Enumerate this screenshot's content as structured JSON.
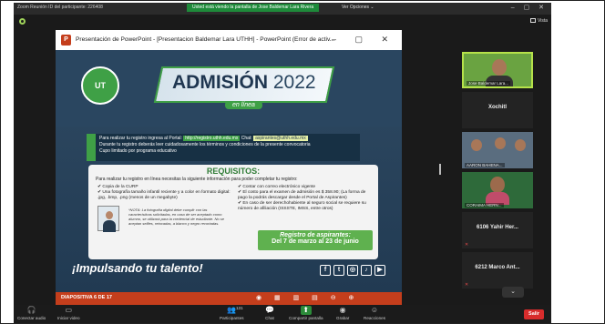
{
  "zoom": {
    "window_title": "Zoom Reunión ID del participante: 226408",
    "banner": "Usted está viendo la pantalla de Jose Baldemar Lara Rivera",
    "view_options": "Ver Opciones ⌄",
    "view_label": "Vista",
    "window_controls": "–  ▢  ✕"
  },
  "ppt": {
    "app_letter": "P",
    "title": "Presentación de PowerPoint - [Presentacion Baldemar Lara UTHH] - PowerPoint (Error de activ...",
    "controls": "–  ▢  ✕",
    "slide_counter": "DIAPOSITIVA 6 DE 17",
    "status_icons": "◉ ▦ ▥ ▤ ⊖ ⊕"
  },
  "slide": {
    "logo_text": "UT",
    "title_main": "ADMISIÓN",
    "title_year": "2022",
    "subtitle": "en línea",
    "portal_line1_pre": "Para realizar tu registro ingresa al Portal:",
    "portal_url": "http://registro.uthh.edu.mx",
    "portal_chat_label": "Chat:",
    "portal_chat": "aspirantes@uthh.edu.mx",
    "portal_line2": "Durante tu registro deberás leer cuidadosamente los términos y condiciones de la presente convocatoria",
    "portal_line3": "Cupo limitado por programa educativo",
    "req_title": "REQUISITOS:",
    "req_intro": "Para realizar tu registro en línea necesitas la siguiente información para poder completar tu registro:",
    "req_left_1": "Copia de la CURP",
    "req_left_2": "Una fotografía tamaño infantil reciente y a color en formato digital: .jpg, .bmp, .png (menos de un megabyte)",
    "nota": "*NOTA: La fotografía digital debe cumplir con las características solicitadas, en caso de ser aceptado como alumno, se utilizará para la credencial de estudiante. No se aceptan selfies, retocadas, a blanco y negro recortadas.",
    "req_right_1": "Contar con correo electrónico vigente",
    "req_right_2": "El costo para el examen de admisión es $ 358.90; (La forma de pago la podrás descargar desde el Portal de Aspirantes)",
    "req_right_3": "En caso de ser derechohabiente al seguro social se requiere su número de afiliación (ISSSTE, IMSS, entre otros)",
    "reg_title": "Registro de aspirantes:",
    "reg_dates": "Del 7 de marzo al 23 de junio",
    "slogan": "¡Impulsando tu talento!",
    "socials": [
      "f",
      "t",
      "◎",
      "♪",
      "▶"
    ]
  },
  "participants": [
    {
      "name": "Jose Baldemar Lara..."
    },
    {
      "name": "Xochitl"
    },
    {
      "name": "AARON BAHENA..."
    },
    {
      "name": "CORAIMA HERN..."
    },
    {
      "name": "6106 Yahir Her..."
    },
    {
      "name": "6212 Marco Ant..."
    }
  ],
  "gallery_chevron": "⌄",
  "toolbar": {
    "audio_label": "Conectar audio",
    "video_label": "Iniciar video",
    "participants_label": "Participantes",
    "participants_count": "131",
    "chat_label": "Chat",
    "share_label": "Compartir pantalla",
    "record_label": "Grabar",
    "reactions_label": "Reacciones",
    "leave_label": "Salir"
  }
}
